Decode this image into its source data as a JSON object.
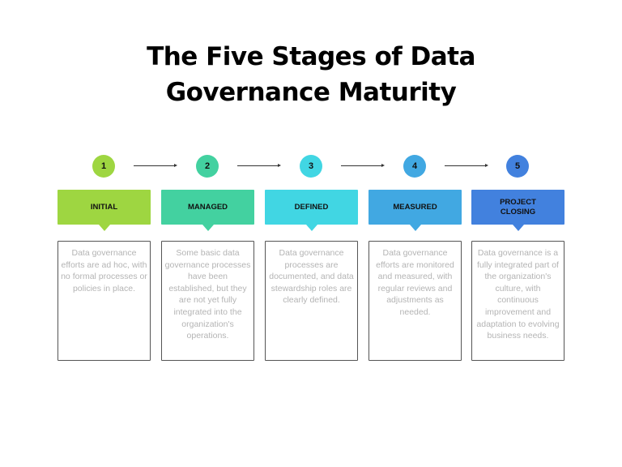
{
  "title": {
    "line1": "The Five Stages of Data",
    "line2": "Governance Maturity"
  },
  "stages": [
    {
      "number": "1",
      "label": "INITIAL",
      "color": "#9ED641",
      "description": "Data governance efforts are ad hoc, with no formal processes or policies in place."
    },
    {
      "number": "2",
      "label": "MANAGED",
      "color": "#43D1A0",
      "description": "Some basic data governance processes have been established, but they are not yet fully integrated into the organization's operations."
    },
    {
      "number": "3",
      "label": "DEFINED",
      "color": "#41D6E3",
      "description": "Data governance processes are documented, and data stewardship roles are clearly defined."
    },
    {
      "number": "4",
      "label": "MEASURED",
      "color": "#41A8E2",
      "description": "Data governance efforts are monitored and measured, with regular reviews and adjustments as needed."
    },
    {
      "number": "5",
      "label": "PROJECT CLOSING",
      "color": "#4281DE",
      "description": "Data governance is a fully integrated part of the organization's culture, with continuous improvement and adaptation to evolving business needs."
    }
  ],
  "arrow_icon": "arrow-right-icon"
}
